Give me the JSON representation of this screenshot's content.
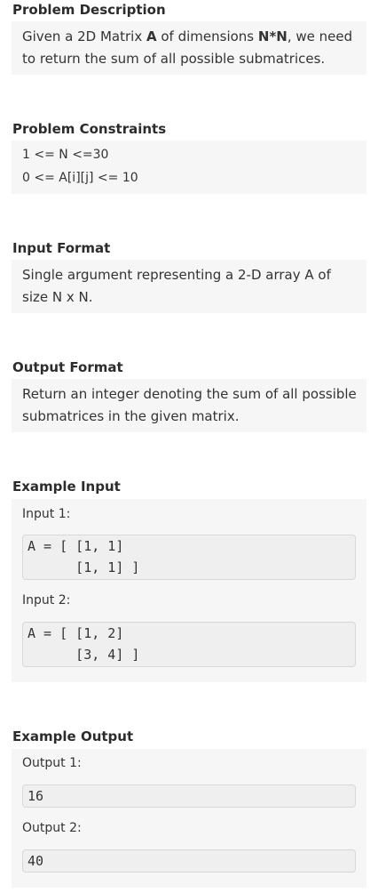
{
  "problem_description": {
    "heading": "Problem Description",
    "text_1": "Given a 2D Matrix ",
    "bold_a": "A",
    "text_2": " of dimensions ",
    "bold_nn": "N*N",
    "text_3": ", we need to return the sum of all possible submatrices."
  },
  "problem_constraints": {
    "heading": "Problem Constraints",
    "lines": [
      "1 <= N <=30",
      "0 <= A[i][j] <= 10"
    ]
  },
  "input_format": {
    "heading": "Input Format",
    "text": "Single argument representing a 2-D array A of size N x N."
  },
  "output_format": {
    "heading": "Output Format",
    "text": "Return an integer denoting the sum of all possible submatrices in the given matrix."
  },
  "example_input": {
    "heading": "Example Input",
    "inputs": [
      {
        "label": "Input 1:",
        "lines": [
          "A = [ [1, 1]",
          "      [1, 1] ]"
        ]
      },
      {
        "label": "Input 2:",
        "lines": [
          "A = [ [1, 2]",
          "      [3, 4] ]"
        ]
      }
    ]
  },
  "example_output": {
    "heading": "Example Output",
    "outputs": [
      {
        "label": "Output 1:",
        "value": "16"
      },
      {
        "label": "Output 2:",
        "value": "40"
      }
    ]
  }
}
